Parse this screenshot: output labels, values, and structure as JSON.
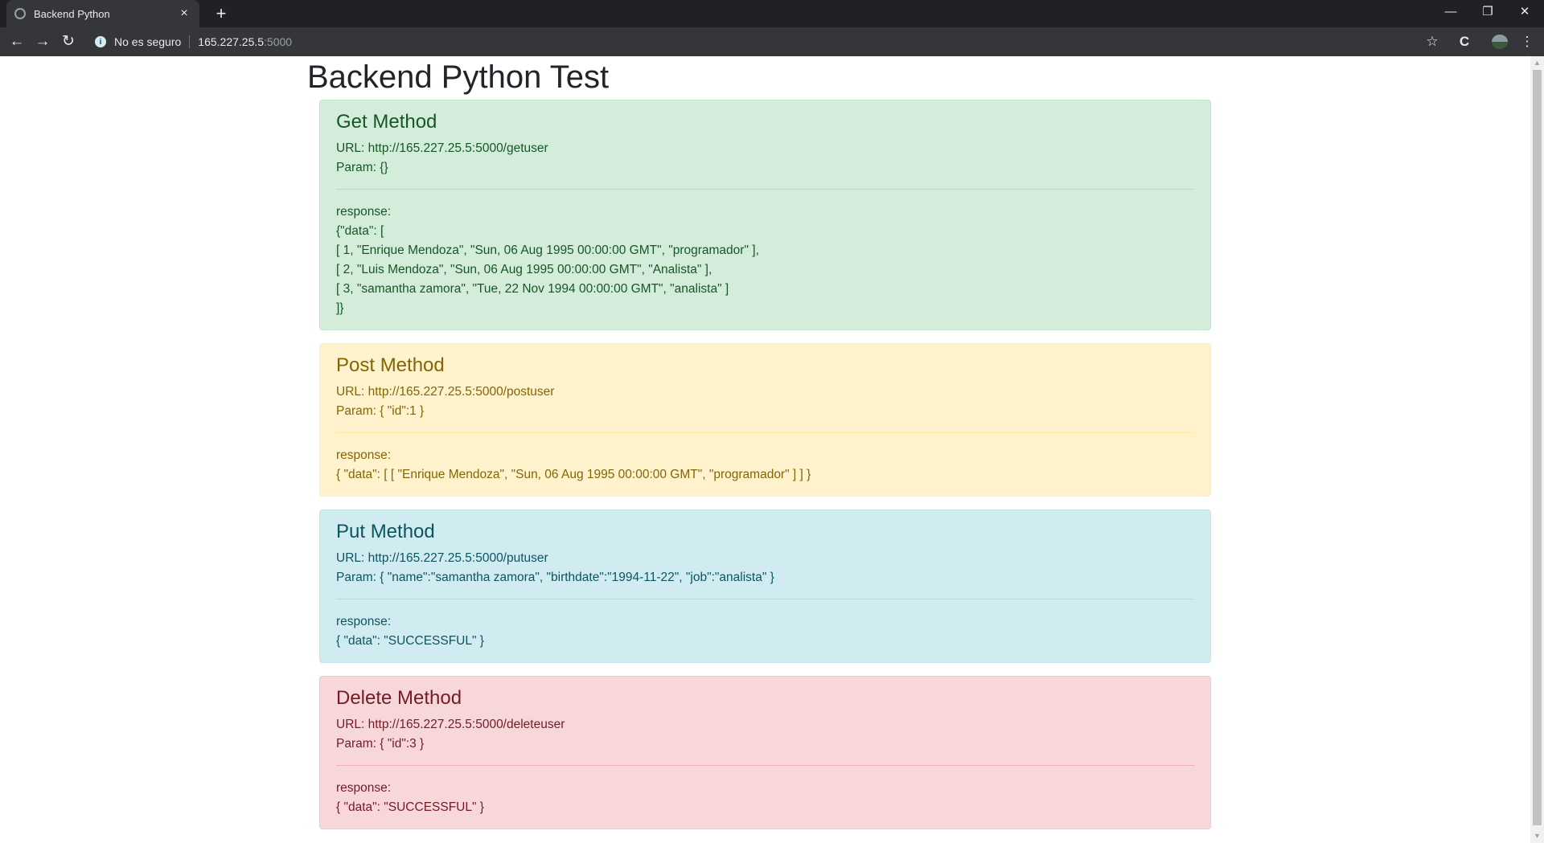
{
  "browser": {
    "tab_title": "Backend Python",
    "tab_close": "×",
    "new_tab": "+",
    "security_text": "No es seguro",
    "host": "165.227.25.5",
    "port": ":5000",
    "window_controls": {
      "minimize": "—",
      "restore": "❐",
      "close": "✕"
    },
    "nav": {
      "back": "←",
      "forward": "→",
      "reload": "↻"
    },
    "toolbar_icons": {
      "bookmark": "☆",
      "extension": "C"
    }
  },
  "page": {
    "title": "Backend Python Test",
    "sections": [
      {
        "heading": "Get Method",
        "url": "URL: http://165.227.25.5:5000/getuser",
        "param": "Param: {}",
        "response_label": "response:",
        "response_lines": [
          "{\"data\": [",
          "[ 1, \"Enrique Mendoza\", \"Sun, 06 Aug 1995 00:00:00 GMT\", \"programador\" ],",
          "[ 2, \"Luis Mendoza\", \"Sun, 06 Aug 1995 00:00:00 GMT\", \"Analista\" ],",
          "[ 3, \"samantha zamora\", \"Tue, 22 Nov 1994 00:00:00 GMT\", \"analista\" ]",
          "]}"
        ]
      },
      {
        "heading": "Post Method",
        "url": "URL: http://165.227.25.5:5000/postuser",
        "param": "Param: { \"id\":1 }",
        "response_label": "response:",
        "response_lines": [
          "{ \"data\": [ [ \"Enrique Mendoza\", \"Sun, 06 Aug 1995 00:00:00 GMT\", \"programador\" ] ] }"
        ]
      },
      {
        "heading": "Put Method",
        "url": "URL: http://165.227.25.5:5000/putuser",
        "param": "Param: { \"name\":\"samantha zamora\", \"birthdate\":\"1994-11-22\", \"job\":\"analista\" }",
        "response_label": "response:",
        "response_lines": [
          "{ \"data\": \"SUCCESSFUL\" }"
        ]
      },
      {
        "heading": "Delete Method",
        "url": "URL: http://165.227.25.5:5000/deleteuser",
        "param": "Param: { \"id\":3 }",
        "response_label": "response:",
        "response_lines": [
          "{ \"data\": \"SUCCESSFUL\" }"
        ]
      }
    ]
  }
}
